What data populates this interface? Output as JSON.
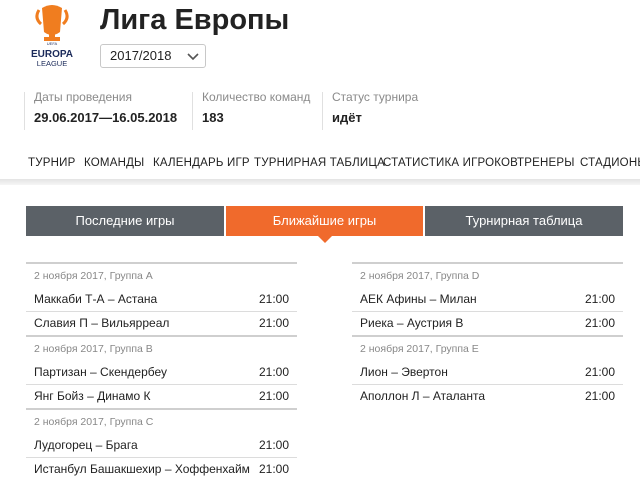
{
  "header": {
    "title": "Лига Европы",
    "logo_text": "UEFA EUROPA LEAGUE",
    "season_selected": "2017/2018"
  },
  "info": [
    {
      "label": "Даты проведения",
      "value": "29.06.2017—16.05.2018"
    },
    {
      "label": "Количество команд",
      "value": "183"
    },
    {
      "label": "Статус турнира",
      "value": "идёт"
    }
  ],
  "nav": [
    "ТУРНИР",
    "КОМАНДЫ",
    "КАЛЕНДАРЬ ИГР",
    "ТУРНИРНАЯ ТАБЛИЦА",
    "СТАТИСТИКА ИГРОКОВ",
    "ТРЕНЕРЫ",
    "СТАДИОНЫ"
  ],
  "tabs": [
    {
      "label": "Последние игры",
      "active": false
    },
    {
      "label": "Ближайшие игры",
      "active": true
    },
    {
      "label": "Турнирная таблица",
      "active": false
    }
  ],
  "left_groups": [
    {
      "header": "2 ноября 2017, Группа A",
      "matches": [
        {
          "teams": "Маккаби Т-А – Астана",
          "time": "21:00"
        },
        {
          "teams": "Славия П – Вильярреал",
          "time": "21:00"
        }
      ]
    },
    {
      "header": "2 ноября 2017, Группа B",
      "matches": [
        {
          "teams": "Партизан – Скендербеу",
          "time": "21:00"
        },
        {
          "teams": "Янг Бойз – Динамо К",
          "time": "21:00"
        }
      ]
    },
    {
      "header": "2 ноября 2017, Группа C",
      "matches": [
        {
          "teams": "Лудогорец – Брага",
          "time": "21:00"
        },
        {
          "teams": "Истанбул Башакшехир – Хоффенхайм",
          "time": "21:00"
        }
      ]
    }
  ],
  "right_groups": [
    {
      "header": "2 ноября 2017, Группа D",
      "matches": [
        {
          "teams": "АЕК Афины – Милан",
          "time": "21:00"
        },
        {
          "teams": "Риека – Аустрия В",
          "time": "21:00"
        }
      ]
    },
    {
      "header": "2 ноября 2017, Группа E",
      "matches": [
        {
          "teams": "Лион – Эвертон",
          "time": "21:00"
        },
        {
          "teams": "Аполлон Л – Аталанта",
          "time": "21:00"
        }
      ]
    }
  ],
  "colors": {
    "accent": "#f06a2c",
    "tab_dark": "#5b6167",
    "logo_orange": "#f07d1f",
    "logo_navy": "#1b2a5a"
  }
}
